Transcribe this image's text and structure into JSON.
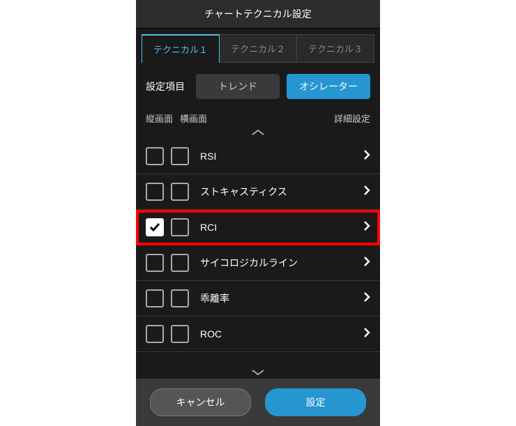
{
  "title": "チャートテクニカル設定",
  "tabs": [
    {
      "label": "テクニカル１",
      "active": true
    },
    {
      "label": "テクニカル２",
      "active": false
    },
    {
      "label": "テクニカル３",
      "active": false
    }
  ],
  "filter": {
    "label": "設定項目",
    "options": [
      {
        "label": "トレンド",
        "active": false
      },
      {
        "label": "オシレーター",
        "active": true
      }
    ]
  },
  "columns": {
    "vertical": "縦画面",
    "horizontal": "横画面",
    "detail": "詳細設定"
  },
  "items": [
    {
      "label": "RSI",
      "checked_v": false,
      "checked_h": false,
      "highlight": false
    },
    {
      "label": "ストキャスティクス",
      "checked_v": false,
      "checked_h": false,
      "highlight": false
    },
    {
      "label": "RCI",
      "checked_v": true,
      "checked_h": false,
      "highlight": true
    },
    {
      "label": "サイコロジカルライン",
      "checked_v": false,
      "checked_h": false,
      "highlight": false
    },
    {
      "label": "乖離率",
      "checked_v": false,
      "checked_h": false,
      "highlight": false
    },
    {
      "label": "ROC",
      "checked_v": false,
      "checked_h": false,
      "highlight": false
    }
  ],
  "footer": {
    "cancel": "キャンセル",
    "submit": "設定"
  }
}
